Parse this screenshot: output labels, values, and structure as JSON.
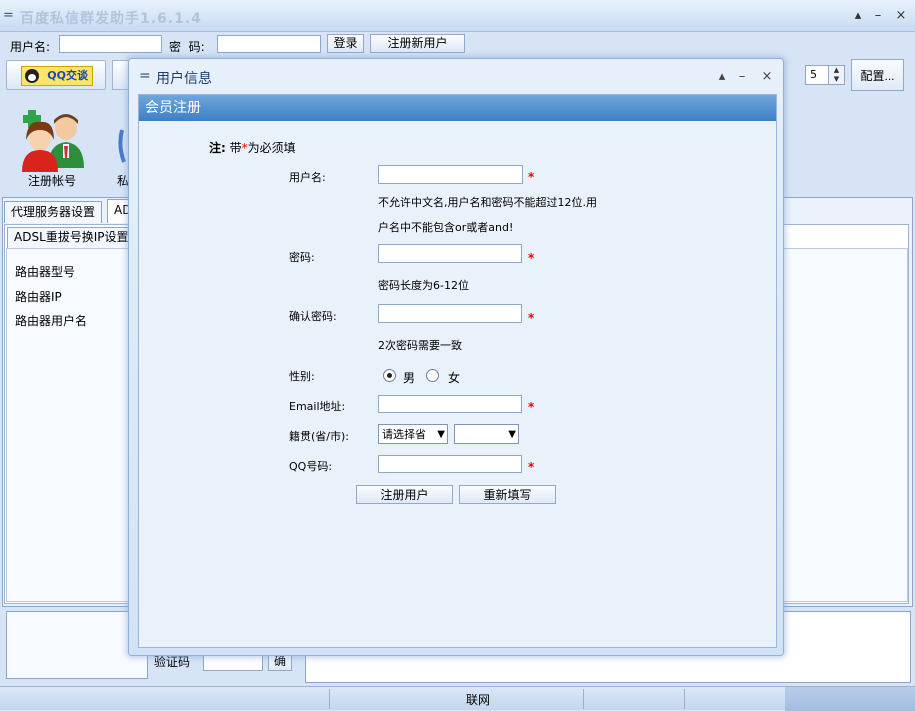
{
  "app": {
    "title": "百度私信群发助手1.6.1.4",
    "title_menu_icon": "=",
    "controls": [
      "▴",
      "–",
      "×"
    ]
  },
  "login": {
    "username_label": "用户名:",
    "username_value": "",
    "password_label": "密  码:",
    "password_value": "",
    "login_button": "登录",
    "register_button": "注册新用户"
  },
  "toolbar": {
    "qq_button": "QQ交谈",
    "spin_value": "5",
    "spin_arrows": "▲\n▼",
    "config_button": "配置..."
  },
  "icons": {
    "register_label": "注册帐号",
    "private_label": "私"
  },
  "tabs": {
    "proxy": "代理服务器设置",
    "adsl": "ADS",
    "adsl_ip": "ADSL重拔号换IP设置"
  },
  "router": {
    "items": [
      "路由器型号",
      "路由器IP",
      "路由器用户名"
    ]
  },
  "bottom": {
    "verify_label": "验证码",
    "verify_value": "",
    "confirm_button": "确"
  },
  "statusbar": {
    "network": "联网"
  },
  "dialog": {
    "title_icon": "=",
    "title": "用户信息",
    "controls": [
      "▴",
      "–",
      "×"
    ],
    "header": "会员注册",
    "note_prefix": "注:",
    "note_before": "带",
    "note_star": "*",
    "note_after": "为必须填",
    "required_mark": "*",
    "username_label": "用户名:",
    "username_hint_1": "不允许中文名,用户名和密码不能超过12位.用",
    "username_hint_2": "户名中不能包含or或者and!",
    "password_label": "密码:",
    "password_hint": "密码长度为6-12位",
    "confirm_label": "确认密码:",
    "confirm_hint": "2次密码需要一致",
    "gender_label": "性别:",
    "gender_male": "男",
    "gender_female": "女",
    "gender_selected": "male",
    "email_label": "Email地址:",
    "origin_label": "籍贯(省/市):",
    "province_value": "请选择省",
    "city_value": "",
    "qq_label": "QQ号码:",
    "submit_button": "注册用户",
    "reset_button": "重新填写"
  }
}
